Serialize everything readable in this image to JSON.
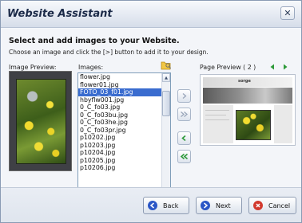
{
  "window": {
    "title": "Website Assistant",
    "close_glyph": "✕"
  },
  "content": {
    "heading": "Select and add images to your Website.",
    "instruction": "Choose an image and click the [>] button to add it to your design."
  },
  "image_preview": {
    "label": "Image Preview:",
    "image_icon": "flower-photo"
  },
  "images": {
    "label": "Images:",
    "items": [
      "flower.jpg",
      "flower01.jpg",
      "FOTO_03_f01.jpg",
      "hbyflw001.jpg",
      "0_C_fo03.jpg",
      "0_C_fo03bu.jpg",
      "0_C_fo03he.jpg",
      "0_C_fo03pr.jpg",
      "p10202.jpg",
      "p10203.jpg",
      "p10204.jpg",
      "p10205.jpg",
      "p10206.jpg"
    ],
    "selected": "FOTO_03_f01.jpg"
  },
  "controls": {
    "add_icon": "chevron-right",
    "add_all_icon": "double-chevron-right",
    "remove_icon": "chevron-left",
    "remove_all_icon": "double-chevron-left"
  },
  "page_preview": {
    "label": "Page Preview  ( 2 )",
    "logo_text": "sorge"
  },
  "footer": {
    "back_label": "Back",
    "next_label": "Next",
    "cancel_label": "Cancel"
  },
  "colors": {
    "selection": "#3a6ccf",
    "arrow_green": "#2e9a3a",
    "button_icon_blue": "#2a56c6",
    "cancel_icon_red": "#d23a2f"
  }
}
